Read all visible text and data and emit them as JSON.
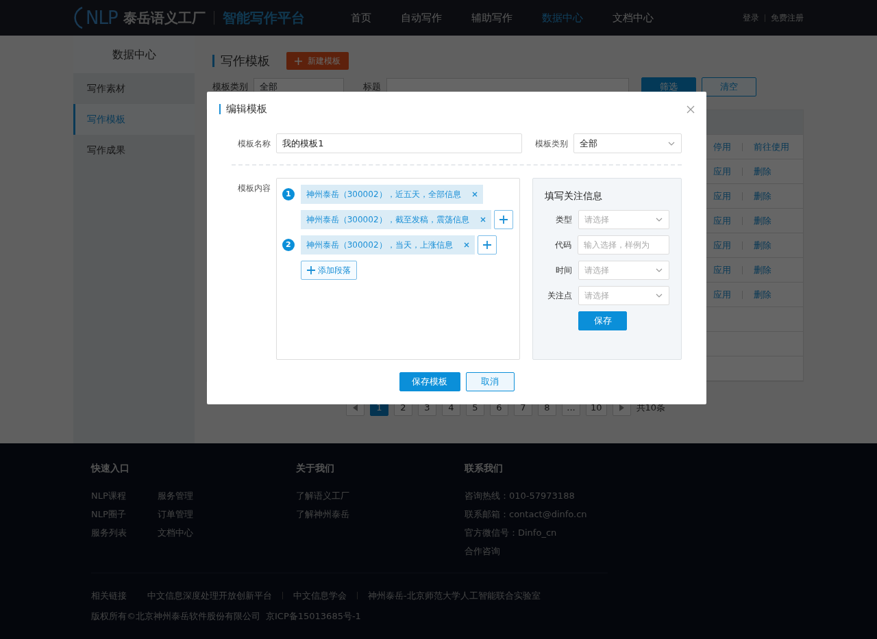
{
  "header": {
    "logo": {
      "mark": "NLP",
      "name": "泰岳语义工厂",
      "product": "智能写作平台"
    },
    "nav": [
      {
        "label": "首页",
        "selected": false
      },
      {
        "label": "自动写作",
        "selected": false
      },
      {
        "label": "辅助写作",
        "selected": false
      },
      {
        "label": "数据中心",
        "selected": true
      },
      {
        "label": "文档中心",
        "selected": false
      }
    ],
    "auth": [
      "登录",
      "免费注册"
    ]
  },
  "sidebar": {
    "title": "数据中心",
    "items": [
      {
        "label": "写作素材",
        "selected": false
      },
      {
        "label": "写作模板",
        "selected": true
      },
      {
        "label": "写作成果",
        "selected": false
      }
    ]
  },
  "page": {
    "title": "写作模板",
    "new_button": "新建模板",
    "filters": [
      {
        "label": "模板类别",
        "value": "全部",
        "kind": "select"
      },
      {
        "label": "标题",
        "kind": "input"
      }
    ],
    "buttons": [
      {
        "label": "筛选",
        "kind": "primary"
      },
      {
        "label": "清空",
        "kind": "secondary"
      }
    ]
  },
  "table": {
    "rows": [
      {
        "actions": [
          "停用",
          "前往使用"
        ]
      },
      {
        "actions": [
          "应用",
          "删除"
        ]
      },
      {
        "actions": [
          "应用",
          "删除"
        ]
      },
      {
        "actions": [
          "应用",
          "删除"
        ]
      },
      {
        "actions": [
          "应用",
          "删除"
        ]
      },
      {
        "actions": [
          "应用",
          "删除"
        ]
      },
      {
        "actions": [
          "应用",
          "删除"
        ]
      },
      {},
      {},
      {}
    ]
  },
  "pagination": {
    "pages": [
      {
        "label": "1",
        "selected": true
      },
      {
        "label": "2",
        "selected": false
      },
      {
        "label": "3",
        "selected": false
      },
      {
        "label": "4",
        "selected": false
      },
      {
        "label": "5",
        "selected": false
      },
      {
        "label": "6",
        "selected": false
      },
      {
        "label": "7",
        "selected": false
      },
      {
        "label": "8",
        "selected": false
      },
      {
        "label": "...",
        "selected": false
      },
      {
        "label": "10",
        "selected": false
      }
    ],
    "total": "共10条"
  },
  "modal": {
    "title": "编辑模板",
    "name_field": {
      "label": "模板名称",
      "value": "我的模板1"
    },
    "category_field": {
      "label": "模板类别",
      "value": "全部"
    },
    "content": {
      "label": "模板内容",
      "paragraphs": [
        {
          "number": "1",
          "items": [
            "神州泰岳（300002），近五天，全部信息",
            "神州泰岳（300002），截至发稿，震荡信息"
          ]
        },
        {
          "number": "2",
          "items": [
            "神州泰岳（300002），当天，上涨信息"
          ]
        }
      ],
      "add_paragraph": "添加段落"
    },
    "focus_panel": {
      "title": "填写关注信息",
      "fields": [
        {
          "label": "类型",
          "placeholder": "请选择",
          "kind": "select"
        },
        {
          "label": "代码",
          "placeholder": "输入选择，样例为",
          "kind": "input"
        },
        {
          "label": "时间",
          "placeholder": "请选择",
          "kind": "select"
        },
        {
          "label": "关注点",
          "placeholder": "请选择",
          "kind": "select"
        }
      ],
      "save": "保存"
    },
    "buttons": [
      {
        "label": "保存模板",
        "kind": "primary"
      },
      {
        "label": "取消",
        "kind": "secondary"
      }
    ]
  },
  "footer": {
    "sections": [
      {
        "title": "快速入口",
        "links": [
          "NLP课程",
          "服务管理",
          "NLP圈子",
          "订单管理",
          "服务列表",
          "文档中心"
        ],
        "kind": "grid"
      },
      {
        "title": "关于我们",
        "links": [
          "了解语义工厂",
          "了解神州泰岳"
        ],
        "kind": "list"
      },
      {
        "title": "联系我们",
        "links": [
          "咨询热线：010-57973188",
          "联系邮箱：contact@dinfo.cn",
          "官方微信号：Dinfo_cn",
          "合作咨询"
        ],
        "kind": "list"
      }
    ],
    "related": {
      "label": "相关链接",
      "links": [
        "中文信息深度处理开放创新平台",
        "中文信息学会",
        "神州泰岳-北京师范大学人工智能联合实验室"
      ]
    },
    "copyright": [
      "版权所有©北京神州泰岳软件股份有限公司",
      "京ICP备15013685号-1"
    ]
  }
}
